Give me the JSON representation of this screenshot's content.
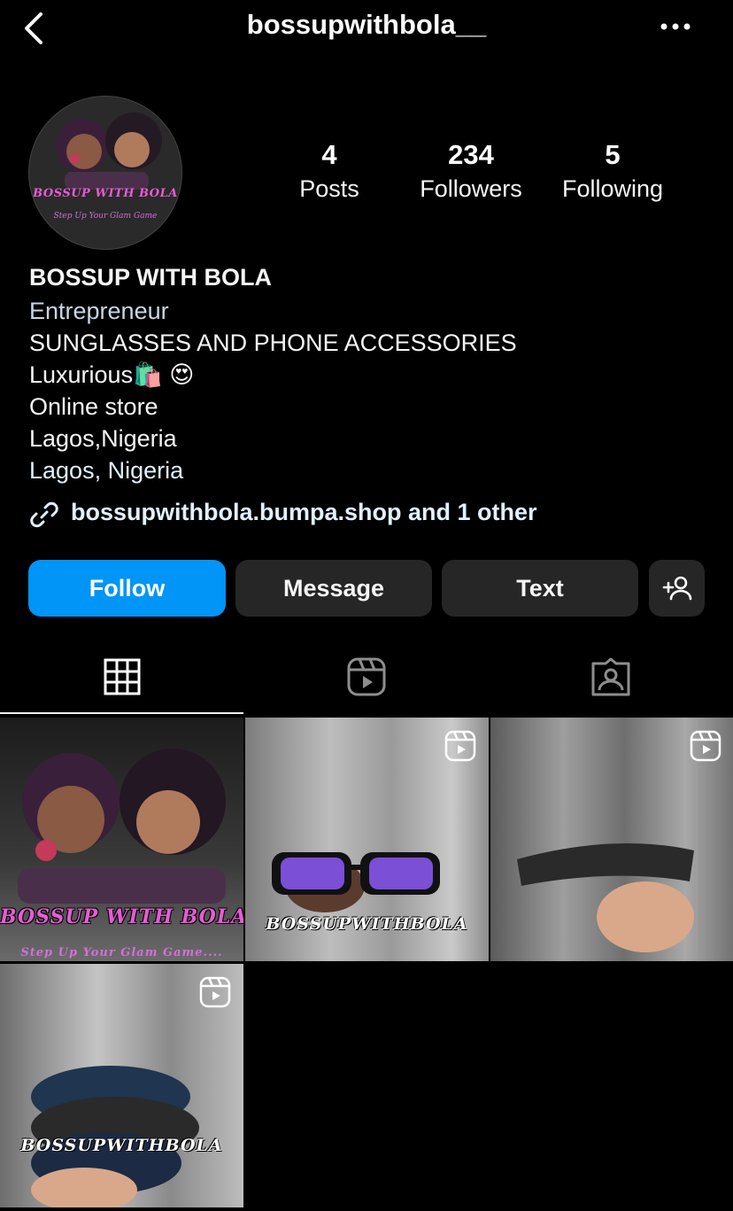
{
  "header": {
    "username": "bossupwithbola__",
    "back_icon": "chevron-left-icon",
    "more_icon": "ellipsis-icon"
  },
  "profile": {
    "avatar_text": "BOSSUP WITH BOLA",
    "avatar_subtext": "Step Up Your Glam Game"
  },
  "stats": [
    {
      "value": "4",
      "label": "Posts"
    },
    {
      "value": "234",
      "label": "Followers"
    },
    {
      "value": "5",
      "label": "Following"
    }
  ],
  "bio": {
    "name": "BOSSUP WITH BOLA",
    "category": "Entrepreneur",
    "lines": [
      "SUNGLASSES AND PHONE ACCESSORIES",
      "Luxurious🛍️ 😍",
      "Online store",
      "Lagos,Nigeria"
    ],
    "location": "Lagos, Nigeria"
  },
  "link": {
    "text": "bossupwithbola.bumpa.shop and 1 other"
  },
  "buttons": {
    "follow": "Follow",
    "message": "Message",
    "text": "Text"
  },
  "tabs": [
    "grid-icon",
    "reels-icon",
    "tagged-icon"
  ],
  "posts": [
    {
      "caption": "BOSSUP WITH BOLA",
      "subcaption": "Step Up Your Glam Game....",
      "is_reel": false
    },
    {
      "caption": "BOSSUPWITHBOLA",
      "is_reel": true
    },
    {
      "caption": "",
      "is_reel": true
    },
    {
      "caption": "BOSSUPWITHBOLA",
      "is_reel": true
    }
  ],
  "colors": {
    "background": "#000000",
    "follow_button": "#0095f6",
    "secondary_button": "#262626"
  }
}
